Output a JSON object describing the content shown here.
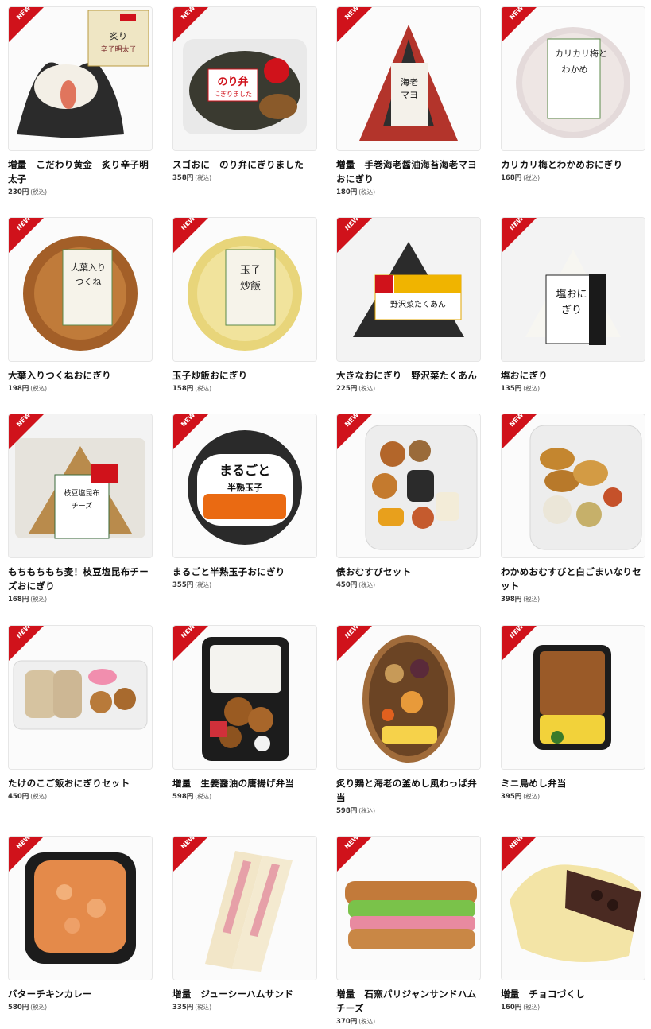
{
  "badge_label": "NEW",
  "colors": {
    "badge": "#d0121b",
    "text": "#111111"
  },
  "products": [
    {
      "name": "増量　こだわり黄金　炙り辛子明太子",
      "price": "230円",
      "tax": "(税込)",
      "icon": "onigiri-photo"
    },
    {
      "name": "スゴおに　のり弁にぎりました",
      "price": "358円",
      "tax": "(税込)",
      "icon": "onigiri-photo"
    },
    {
      "name": "増量　手巻海老醤油海苔海老マヨおにぎり",
      "price": "180円",
      "tax": "(税込)",
      "icon": "onigiri-photo"
    },
    {
      "name": "カリカリ梅とわかめおにぎり",
      "price": "168円",
      "tax": "(税込)",
      "icon": "onigiri-photo"
    },
    {
      "name": "大葉入りつくねおにぎり",
      "price": "198円",
      "tax": "(税込)",
      "icon": "onigiri-photo"
    },
    {
      "name": "玉子炒飯おにぎり",
      "price": "158円",
      "tax": "(税込)",
      "icon": "onigiri-photo"
    },
    {
      "name": "大きなおにぎり　野沢菜たくあん",
      "price": "225円",
      "tax": "(税込)",
      "icon": "onigiri-photo"
    },
    {
      "name": "塩おにぎり",
      "price": "135円",
      "tax": "(税込)",
      "icon": "onigiri-photo"
    },
    {
      "name": "もちもちもち麦！枝豆塩昆布チーズおにぎり",
      "price": "168円",
      "tax": "(税込)",
      "icon": "onigiri-photo"
    },
    {
      "name": "まるごと半熟玉子おにぎり",
      "price": "355円",
      "tax": "(税込)",
      "icon": "onigiri-photo"
    },
    {
      "name": "俵おむすびセット",
      "price": "450円",
      "tax": "(税込)",
      "icon": "pack-photo"
    },
    {
      "name": "わかめおむすびと白ごまいなりセット",
      "price": "398円",
      "tax": "(税込)",
      "icon": "pack-photo"
    },
    {
      "name": "たけのこご飯おにぎりセット",
      "price": "450円",
      "tax": "(税込)",
      "icon": "pack-photo"
    },
    {
      "name": "増量　生姜醤油の唐揚げ弁当",
      "price": "598円",
      "tax": "(税込)",
      "icon": "bento-photo"
    },
    {
      "name": "炙り鶏と海老の釜めし風わっぱ弁当",
      "price": "598円",
      "tax": "(税込)",
      "icon": "bento-photo"
    },
    {
      "name": "ミニ鳥めし弁当",
      "price": "395円",
      "tax": "(税込)",
      "icon": "bento-photo"
    },
    {
      "name": "バターチキンカレー",
      "price": "580円",
      "tax": "(税込)",
      "icon": "curry-photo"
    },
    {
      "name": "増量　ジューシーハムサンド",
      "price": "335円",
      "tax": "(税込)",
      "icon": "sandwich-photo"
    },
    {
      "name": "増量　石窯パリジャンサンドハムチーズ",
      "price": "370円",
      "tax": "(税込)",
      "icon": "sandwich-photo"
    },
    {
      "name": "増量　チョコづくし",
      "price": "160円",
      "tax": "(税込)",
      "icon": "bread-photo"
    }
  ]
}
